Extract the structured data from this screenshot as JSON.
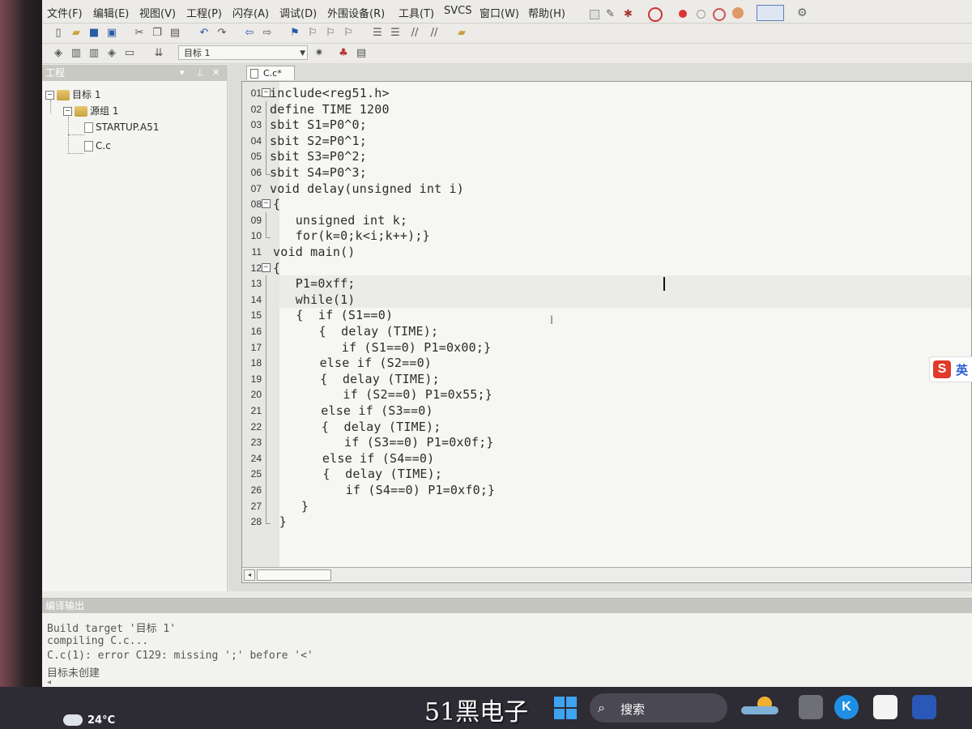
{
  "menu": {
    "items": [
      "文件(F)",
      "编辑(E)",
      "视图(V)",
      "工程(P)",
      "闪存(A)",
      "调试(D)",
      "外围设备(R)",
      "工具(T)",
      "SVCS",
      "窗口(W)",
      "帮助(H)"
    ]
  },
  "toolbar": {
    "target_name": "目标 1"
  },
  "project_panel": {
    "title": "工程",
    "tree": {
      "target": "目标 1",
      "group": "源组 1",
      "files": [
        "STARTUP.A51",
        "C.c"
      ]
    }
  },
  "editor": {
    "tab_label": "C.c*",
    "lines": [
      {
        "num": "01",
        "text": "include<reg51.h>"
      },
      {
        "num": "02",
        "text": "define TIME 1200"
      },
      {
        "num": "03",
        "text": "sbit S1=P0^0;"
      },
      {
        "num": "04",
        "text": "sbit S2=P0^1;"
      },
      {
        "num": "05",
        "text": "sbit S3=P0^2;"
      },
      {
        "num": "06",
        "text": "sbit S4=P0^3;"
      },
      {
        "num": "07",
        "text": "void delay(unsigned int i)"
      },
      {
        "num": "08",
        "text": "{"
      },
      {
        "num": "09",
        "text": "   unsigned int k;"
      },
      {
        "num": "10",
        "text": "   for(k=0;k<i;k++);}"
      },
      {
        "num": "11",
        "text": "void main()"
      },
      {
        "num": "12",
        "text": "{"
      },
      {
        "num": "13",
        "text": "   P1=0xff;"
      },
      {
        "num": "14",
        "text": "   while(1)"
      },
      {
        "num": "15",
        "text": "   {  if (S1==0)"
      },
      {
        "num": "16",
        "text": "      {  delay (TIME);"
      },
      {
        "num": "17",
        "text": "         if (S1==0) P1=0x00;}"
      },
      {
        "num": "18",
        "text": "      else if (S2==0)"
      },
      {
        "num": "19",
        "text": "      {  delay (TIME);"
      },
      {
        "num": "20",
        "text": "         if (S2==0) P1=0x55;}"
      },
      {
        "num": "21",
        "text": "      else if (S3==0)"
      },
      {
        "num": "22",
        "text": "      {  delay (TIME);"
      },
      {
        "num": "23",
        "text": "         if (S3==0) P1=0x0f;}"
      },
      {
        "num": "24",
        "text": "      else if (S4==0)"
      },
      {
        "num": "25",
        "text": "      {  delay (TIME);"
      },
      {
        "num": "26",
        "text": "         if (S4==0) P1=0xf0;}"
      },
      {
        "num": "27",
        "text": "   }"
      },
      {
        "num": "28",
        "text": "}"
      }
    ]
  },
  "ime": {
    "label": "英"
  },
  "build_output": {
    "title": "编译输出",
    "lines": [
      "Build target '目标 1'",
      "compiling C.c...",
      "C.c(1): error C129: missing ';' before '<'",
      "目标未创建"
    ]
  },
  "taskbar": {
    "temperature": "24°C",
    "watermark": "51黑电子",
    "search_label": "搜索"
  },
  "colors": {
    "ide_bg": "#ecebe7",
    "editor_bg": "#f6f6f3",
    "taskbar_bg": "#2d2b33",
    "windows_blue": "#3ea3f0",
    "ime_red": "#e03a2a"
  }
}
